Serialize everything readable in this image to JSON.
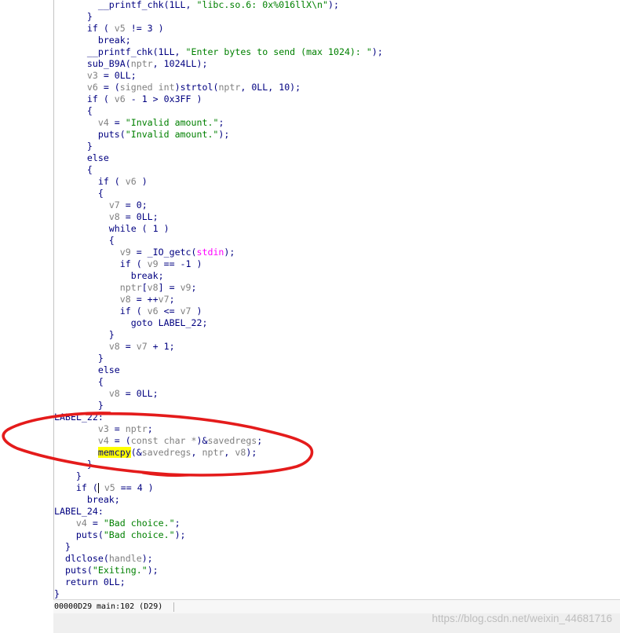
{
  "colors": {
    "code": "#000080",
    "var": "#808080",
    "type": "#808080",
    "str": "#008000",
    "glob": "#ff00ff",
    "hl": "#ffff00",
    "cursor": "#000000",
    "annotation": "#e41b1b"
  },
  "code": {
    "lines": [
      [
        {
          "code": "        __printf_chk(1LL, "
        },
        {
          "str": "\"libc.so.6: 0x%016llX\\n\""
        },
        {
          "code": ");"
        }
      ],
      [
        {
          "code": "      }"
        }
      ],
      [
        {
          "code": "      if ( "
        },
        {
          "var": "v5"
        },
        {
          "code": " != 3 )"
        }
      ],
      [
        {
          "code": "        break;"
        }
      ],
      [
        {
          "code": "      __printf_chk(1LL, "
        },
        {
          "str": "\"Enter bytes to send (max 1024): \""
        },
        {
          "code": ");"
        }
      ],
      [
        {
          "code": "      sub_B9A("
        },
        {
          "var": "nptr"
        },
        {
          "code": ", 1024LL);"
        }
      ],
      [
        {
          "code": "      "
        },
        {
          "var": "v3"
        },
        {
          "code": " = 0LL;"
        }
      ],
      [
        {
          "code": "      "
        },
        {
          "var": "v6"
        },
        {
          "code": " = ("
        },
        {
          "type": "signed int"
        },
        {
          "code": ")strtol("
        },
        {
          "var": "nptr"
        },
        {
          "code": ", 0LL, 10);"
        }
      ],
      [
        {
          "code": "      if ( "
        },
        {
          "var": "v6"
        },
        {
          "code": " - 1 > 0x3FF )"
        }
      ],
      [
        {
          "code": "      {"
        }
      ],
      [
        {
          "code": "        "
        },
        {
          "var": "v4"
        },
        {
          "code": " = "
        },
        {
          "str": "\"Invalid amount.\""
        },
        {
          "code": ";"
        }
      ],
      [
        {
          "code": "        puts("
        },
        {
          "str": "\"Invalid amount.\""
        },
        {
          "code": ");"
        }
      ],
      [
        {
          "code": "      }"
        }
      ],
      [
        {
          "code": "      else"
        }
      ],
      [
        {
          "code": "      {"
        }
      ],
      [
        {
          "code": "        if ( "
        },
        {
          "var": "v6"
        },
        {
          "code": " )"
        }
      ],
      [
        {
          "code": "        {"
        }
      ],
      [
        {
          "code": "          "
        },
        {
          "var": "v7"
        },
        {
          "code": " = 0;"
        }
      ],
      [
        {
          "code": "          "
        },
        {
          "var": "v8"
        },
        {
          "code": " = 0LL;"
        }
      ],
      [
        {
          "code": "          while ( 1 )"
        }
      ],
      [
        {
          "code": "          {"
        }
      ],
      [
        {
          "code": "            "
        },
        {
          "var": "v9"
        },
        {
          "code": " = _IO_getc("
        },
        {
          "glob": "stdin"
        },
        {
          "code": ");"
        }
      ],
      [
        {
          "code": "            if ( "
        },
        {
          "var": "v9"
        },
        {
          "code": " == -1 )"
        }
      ],
      [
        {
          "code": "              break;"
        }
      ],
      [
        {
          "code": "            "
        },
        {
          "var": "nptr"
        },
        {
          "code": "["
        },
        {
          "var": "v8"
        },
        {
          "code": "] = "
        },
        {
          "var": "v9"
        },
        {
          "code": ";"
        }
      ],
      [
        {
          "code": "            "
        },
        {
          "var": "v8"
        },
        {
          "code": " = ++"
        },
        {
          "var": "v7"
        },
        {
          "code": ";"
        }
      ],
      [
        {
          "code": "            if ( "
        },
        {
          "var": "v6"
        },
        {
          "code": " <= "
        },
        {
          "var": "v7"
        },
        {
          "code": " )"
        }
      ],
      [
        {
          "code": "              goto LABEL_22;"
        }
      ],
      [
        {
          "code": "          }"
        }
      ],
      [
        {
          "code": "          "
        },
        {
          "var": "v8"
        },
        {
          "code": " = "
        },
        {
          "var": "v7"
        },
        {
          "code": " + 1;"
        }
      ],
      [
        {
          "code": "        }"
        }
      ],
      [
        {
          "code": "        else"
        }
      ],
      [
        {
          "code": "        {"
        }
      ],
      [
        {
          "code": "          "
        },
        {
          "var": "v8"
        },
        {
          "code": " = 0LL;"
        }
      ],
      [
        {
          "code": "        }"
        }
      ],
      [
        {
          "code": "LABEL_22:"
        }
      ],
      [
        {
          "code": "        "
        },
        {
          "var": "v3"
        },
        {
          "code": " = "
        },
        {
          "var": "nptr"
        },
        {
          "code": ";"
        }
      ],
      [
        {
          "code": "        "
        },
        {
          "var": "v4"
        },
        {
          "code": " = ("
        },
        {
          "type": "const char *"
        },
        {
          "code": ")&"
        },
        {
          "var": "savedregs"
        },
        {
          "code": ";"
        }
      ],
      [
        {
          "code": "        "
        },
        {
          "hl": "memcpy"
        },
        {
          "code": "(&"
        },
        {
          "var": "savedregs"
        },
        {
          "code": ", "
        },
        {
          "var": "nptr"
        },
        {
          "code": ", "
        },
        {
          "var": "v8"
        },
        {
          "code": ");"
        }
      ],
      [
        {
          "code": "      }"
        }
      ],
      [
        {
          "code": "    }"
        }
      ],
      [
        {
          "code": "    if ("
        },
        {
          "cursor": true
        },
        {
          "code": " "
        },
        {
          "var": "v5"
        },
        {
          "code": " == 4 )"
        }
      ],
      [
        {
          "code": "      break;"
        }
      ],
      [
        {
          "code": "LABEL_24:"
        }
      ],
      [
        {
          "code": "    "
        },
        {
          "var": "v4"
        },
        {
          "code": " = "
        },
        {
          "str": "\"Bad choice.\""
        },
        {
          "code": ";"
        }
      ],
      [
        {
          "code": "    puts("
        },
        {
          "str": "\"Bad choice.\""
        },
        {
          "code": ");"
        }
      ],
      [
        {
          "code": "  }"
        }
      ],
      [
        {
          "code": "  dlclose("
        },
        {
          "var": "handle"
        },
        {
          "code": ");"
        }
      ],
      [
        {
          "code": "  puts("
        },
        {
          "str": "\"Exiting.\""
        },
        {
          "code": ");"
        }
      ],
      [
        {
          "code": "  return 0LL;"
        }
      ],
      [
        {
          "code": "}"
        }
      ]
    ]
  },
  "status": {
    "address": "00000D29",
    "location": "main:102 (D29)"
  },
  "watermark": "https://blog.csdn.net/weixin_44681716"
}
